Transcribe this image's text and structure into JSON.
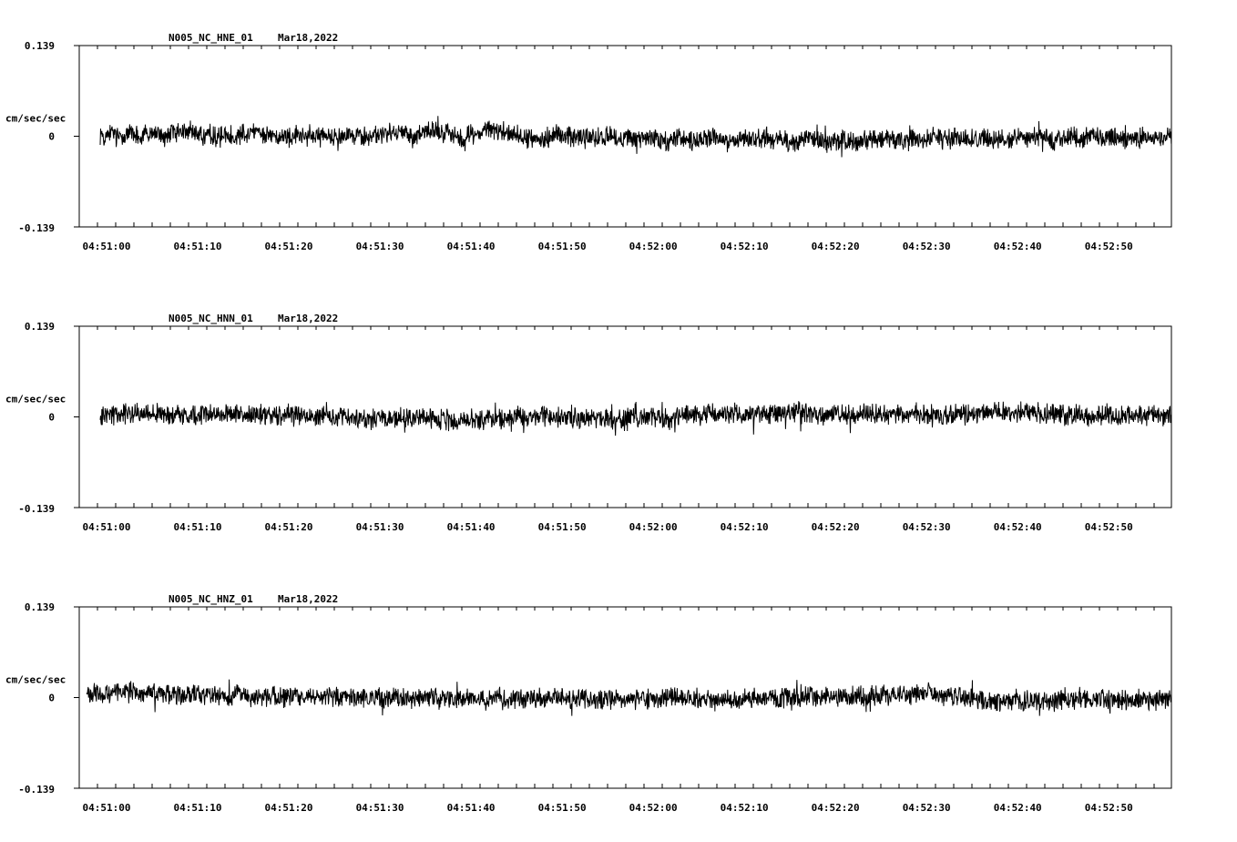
{
  "chart_data": [
    {
      "type": "line",
      "title": "N005_NC_HNE_01",
      "date": "Mar18,2022",
      "ylabel": "cm/sec/sec",
      "ylim": [
        -0.139,
        0.139
      ],
      "ytick_labels": [
        "0.139",
        "0",
        "-0.139"
      ],
      "xtick_labels": [
        "04:51:00",
        "04:51:10",
        "04:51:20",
        "04:51:30",
        "04:51:40",
        "04:51:50",
        "04:52:00",
        "04:52:10",
        "04:52:20",
        "04:52:30",
        "04:52:40",
        "04:52:50"
      ],
      "x_start": "04:50:59",
      "x_end": "04:52:57",
      "series": [
        {
          "start": "04:50:59.3",
          "sample_interval_s": 0.5,
          "y": [
            0.004,
            -0.002,
            0.006,
            0.003,
            -0.004,
            0.005,
            0.002,
            0.006,
            0.003,
            -0.003,
            0.004,
            0.001,
            0.005,
            0.002,
            -0.004,
            0.003,
            0.006,
            0.004,
            0.008,
            0.01,
            0.007,
            0.005,
            0.004,
            -0.002,
            0.003,
            0.001,
            -0.003,
            0.002,
            0.004,
            0.001,
            -0.002,
            0.005,
            0.006,
            0.007,
            0.008,
            0.005,
            0.003,
            0.004,
            0.002,
            -0.001,
            0.003,
            0.001,
            -0.004,
            0.002,
            0.0,
            -0.003,
            0.002,
            0.001,
            -0.002,
            0.003,
            0.002,
            -0.001,
            0.003,
            0.004,
            0.005,
            0.002,
            -0.002,
            0.001,
            0.0,
            -0.003,
            0.002,
            0.001,
            0.003,
            0.006,
            0.004,
            0.002,
            0.005,
            0.003,
            0.001,
            -0.002,
            0.004,
            0.005,
            0.006,
            0.008,
            0.009,
            0.007,
            0.005,
            0.004,
            0.003,
            -0.001,
            0.001,
            0.002,
            0.004,
            0.006,
            0.008,
            0.01,
            0.011,
            0.009,
            0.008,
            0.006,
            0.004,
            0.003,
            0.001,
            -0.002,
            -0.003,
            -0.004,
            -0.003,
            -0.002,
            -0.001,
            0.001,
            0.002,
            0.003,
            0.002,
            0.0,
            -0.002,
            -0.001,
            0.001,
            -0.002,
            -0.004,
            -0.003,
            -0.001,
            0.002,
            -0.001,
            -0.003,
            -0.004,
            -0.002,
            -0.001,
            -0.003,
            -0.004,
            -0.005,
            -0.003,
            -0.002,
            -0.004,
            -0.006,
            -0.007,
            -0.005,
            -0.003,
            -0.002,
            -0.004,
            -0.006,
            -0.008,
            -0.007,
            -0.005,
            -0.003,
            -0.002,
            -0.004,
            -0.006,
            -0.008,
            -0.009,
            -0.007,
            -0.006,
            -0.004,
            -0.003,
            -0.005,
            -0.006,
            -0.004,
            -0.002,
            -0.001,
            -0.003,
            -0.005,
            -0.006,
            -0.008,
            -0.009,
            -0.007,
            -0.005,
            -0.003,
            -0.004,
            -0.006,
            -0.008,
            -0.01,
            -0.009,
            -0.007,
            -0.005,
            -0.004,
            -0.006,
            -0.008,
            -0.01,
            -0.009,
            -0.007,
            -0.005,
            -0.004,
            -0.006,
            -0.005,
            -0.003,
            -0.002,
            -0.004,
            -0.006,
            -0.007,
            -0.005,
            -0.003,
            -0.002,
            -0.004,
            -0.003,
            -0.001,
            -0.002,
            -0.004,
            -0.005,
            -0.003,
            -0.001,
            -0.002,
            -0.004,
            -0.006,
            -0.005,
            -0.003,
            -0.002,
            -0.004,
            -0.006,
            -0.004,
            -0.003,
            -0.005,
            -0.004,
            -0.002,
            -0.001,
            -0.003,
            -0.004,
            -0.002,
            -0.001,
            -0.003,
            -0.004,
            -0.006,
            -0.005,
            -0.003,
            -0.002,
            0.0,
            -0.002,
            -0.003,
            -0.004,
            -0.002,
            -0.001,
            -0.003,
            -0.004,
            -0.002,
            0.0,
            -0.002,
            -0.003,
            -0.004,
            -0.002
          ]
        }
      ]
    },
    {
      "type": "line",
      "title": "N005_NC_HNN_01",
      "date": "Mar18,2022",
      "ylabel": "cm/sec/sec",
      "ylim": [
        -0.139,
        0.139
      ],
      "ytick_labels": [
        "0.139",
        "0",
        "-0.139"
      ],
      "xtick_labels": [
        "04:51:00",
        "04:51:10",
        "04:51:20",
        "04:51:30",
        "04:51:40",
        "04:51:50",
        "04:52:00",
        "04:52:10",
        "04:52:20",
        "04:52:30",
        "04:52:40",
        "04:52:50"
      ],
      "x_start": "04:50:59",
      "x_end": "04:52:57",
      "series": [
        {
          "start": "04:50:59.3",
          "sample_interval_s": 0.5,
          "y": [
            -0.004,
            0.002,
            0.004,
            0.006,
            0.005,
            0.003,
            0.004,
            0.006,
            0.007,
            0.005,
            0.004,
            0.003,
            0.005,
            0.006,
            0.004,
            0.002,
            0.003,
            0.005,
            0.004,
            0.002,
            0.001,
            0.003,
            0.005,
            0.006,
            0.004,
            0.003,
            0.005,
            0.007,
            0.006,
            0.004,
            0.003,
            0.002,
            0.004,
            0.006,
            0.005,
            0.003,
            0.002,
            0.004,
            0.003,
            0.001,
            0.002,
            0.004,
            0.003,
            0.001,
            0.0,
            0.002,
            0.001,
            -0.001,
            0.0,
            0.002,
            0.001,
            -0.001,
            -0.002,
            0.0,
            -0.001,
            -0.003,
            -0.002,
            0.0,
            -0.001,
            -0.003,
            -0.004,
            -0.002,
            -0.001,
            -0.003,
            -0.004,
            -0.003,
            -0.001,
            0.0,
            -0.002,
            -0.003,
            -0.001,
            0.001,
            0.0,
            -0.002,
            -0.003,
            -0.005,
            -0.004,
            -0.006,
            -0.007,
            -0.005,
            -0.004,
            -0.003,
            -0.005,
            -0.004,
            -0.002,
            -0.003,
            -0.001,
            0.0,
            -0.002,
            -0.003,
            -0.001,
            0.001,
            0.002,
            0.0,
            -0.001,
            0.001,
            0.002,
            0.003,
            0.001,
            0.0,
            -0.002,
            -0.001,
            0.001,
            0.002,
            0.0,
            -0.002,
            -0.003,
            -0.001,
            -0.002,
            -0.004,
            -0.005,
            -0.003,
            -0.002,
            -0.004,
            -0.003,
            -0.001,
            0.0,
            -0.002,
            -0.001,
            0.001,
            0.002,
            0.0,
            -0.001,
            -0.003,
            -0.002,
            -0.004,
            -0.003,
            0.001,
            0.004,
            0.006,
            0.005,
            0.003,
            0.004,
            0.006,
            0.005,
            0.007,
            0.006,
            0.004,
            0.003,
            0.005,
            0.004,
            0.002,
            0.003,
            0.005,
            0.006,
            0.004,
            0.003,
            0.005,
            0.007,
            0.006,
            0.004,
            0.005,
            0.007,
            0.008,
            0.006,
            0.004,
            0.003,
            0.005,
            0.004,
            0.002,
            0.003,
            0.005,
            0.004,
            0.002,
            0.001,
            0.003,
            0.005,
            0.006,
            0.004,
            0.003,
            0.005,
            0.004,
            0.002,
            0.001,
            0.003,
            0.004,
            0.002,
            0.001,
            0.003,
            0.005,
            0.004,
            0.002,
            0.003,
            0.005,
            0.004,
            0.002,
            0.001,
            0.003,
            0.005,
            0.006,
            0.004,
            0.003,
            0.005,
            0.007,
            0.008,
            0.006,
            0.005,
            0.007,
            0.008,
            0.009,
            0.007,
            0.006,
            0.008,
            0.007,
            0.005,
            0.004,
            0.006,
            0.005,
            0.003,
            0.004,
            0.006,
            0.005,
            0.003,
            0.004,
            0.006,
            0.005,
            0.003,
            0.002,
            0.004,
            0.003,
            0.002,
            0.004,
            0.003,
            0.001,
            0.002,
            0.003,
            0.002,
            0.001
          ]
        }
      ]
    },
    {
      "type": "line",
      "title": "N005_NC_HNZ_01",
      "date": "Mar18,2022",
      "ylabel": "cm/sec/sec",
      "ylim": [
        -0.139,
        0.139
      ],
      "ytick_labels": [
        "0.139",
        "0",
        "-0.139"
      ],
      "xtick_labels": [
        "04:51:00",
        "04:51:10",
        "04:51:20",
        "04:51:30",
        "04:51:40",
        "04:51:50",
        "04:52:00",
        "04:52:10",
        "04:52:20",
        "04:52:30",
        "04:52:40",
        "04:52:50"
      ],
      "x_start": "04:50:59",
      "x_end": "04:52:57",
      "series": [
        {
          "start": "04:50:57.8",
          "sample_interval_s": 0.5,
          "y": [
            0.003,
            0.006,
            0.008,
            0.007,
            0.005,
            0.006,
            0.008,
            0.009,
            0.007,
            0.006,
            0.008,
            0.007,
            0.005,
            0.006,
            0.008,
            0.007,
            0.005,
            0.004,
            0.006,
            0.005,
            0.003,
            0.004,
            0.006,
            0.005,
            0.004,
            0.006,
            0.005,
            0.003,
            0.002,
            0.004,
            0.003,
            0.001,
            0.002,
            0.004,
            0.003,
            0.001,
            0.0,
            0.002,
            0.001,
            -0.001,
            0.0,
            0.002,
            0.001,
            0.0,
            0.002,
            0.003,
            0.004,
            0.002,
            0.001,
            0.003,
            0.002,
            0.0,
            0.001,
            0.003,
            0.002,
            0.001,
            -0.001,
            0.0,
            0.002,
            0.001,
            -0.001,
            0.0,
            -0.002,
            -0.001,
            0.001,
            0.0,
            -0.002,
            -0.001,
            0.001,
            0.0,
            -0.002,
            -0.003,
            -0.001,
            0.0,
            -0.002,
            -0.001,
            0.001,
            0.0,
            -0.002,
            -0.001,
            -0.003,
            -0.002,
            0.0,
            -0.001,
            -0.003,
            -0.002,
            0.0,
            -0.001,
            -0.003,
            -0.004,
            -0.002,
            -0.001,
            -0.003,
            -0.002,
            0.0,
            -0.001,
            -0.003,
            -0.002,
            0.0,
            -0.001,
            -0.003,
            -0.004,
            -0.002,
            -0.001,
            -0.003,
            -0.002,
            -0.004,
            -0.003,
            -0.001,
            -0.002,
            -0.004,
            -0.005,
            -0.003,
            -0.004,
            -0.002,
            -0.003,
            -0.001,
            -0.002,
            -0.004,
            -0.003,
            -0.001,
            -0.002,
            -0.004,
            -0.003,
            -0.001,
            0.0,
            -0.002,
            -0.001,
            0.001,
            0.0,
            -0.002,
            -0.001,
            0.001,
            0.0,
            -0.002,
            -0.003,
            -0.001,
            -0.002,
            -0.004,
            -0.003,
            -0.001,
            -0.002,
            -0.004,
            -0.003,
            -0.001,
            0.0,
            -0.002,
            -0.001,
            -0.003,
            -0.002,
            0.0,
            -0.001,
            -0.003,
            -0.002,
            0.0,
            0.001,
            -0.001,
            0.0,
            0.002,
            0.001,
            -0.001,
            0.0,
            0.002,
            0.001,
            -0.001,
            0.0,
            0.002,
            0.003,
            0.001,
            0.002,
            0.004,
            0.003,
            0.001,
            0.002,
            0.004,
            0.005,
            0.003,
            0.004,
            0.006,
            0.005,
            0.003,
            0.004,
            0.006,
            0.007,
            0.005,
            0.006,
            0.004,
            0.005,
            0.003,
            0.002,
            0.004,
            0.003,
            0.001,
            0.0,
            -0.002,
            -0.001,
            -0.003,
            -0.004,
            -0.006,
            -0.005,
            -0.007,
            -0.006,
            -0.004,
            -0.005,
            -0.003,
            -0.004,
            -0.006,
            -0.005,
            -0.003,
            -0.004,
            -0.006,
            -0.007,
            -0.005,
            -0.004,
            -0.006,
            -0.005,
            -0.003,
            -0.004,
            -0.002,
            -0.003,
            -0.001,
            -0.002,
            -0.004,
            -0.003
          ]
        }
      ]
    }
  ]
}
